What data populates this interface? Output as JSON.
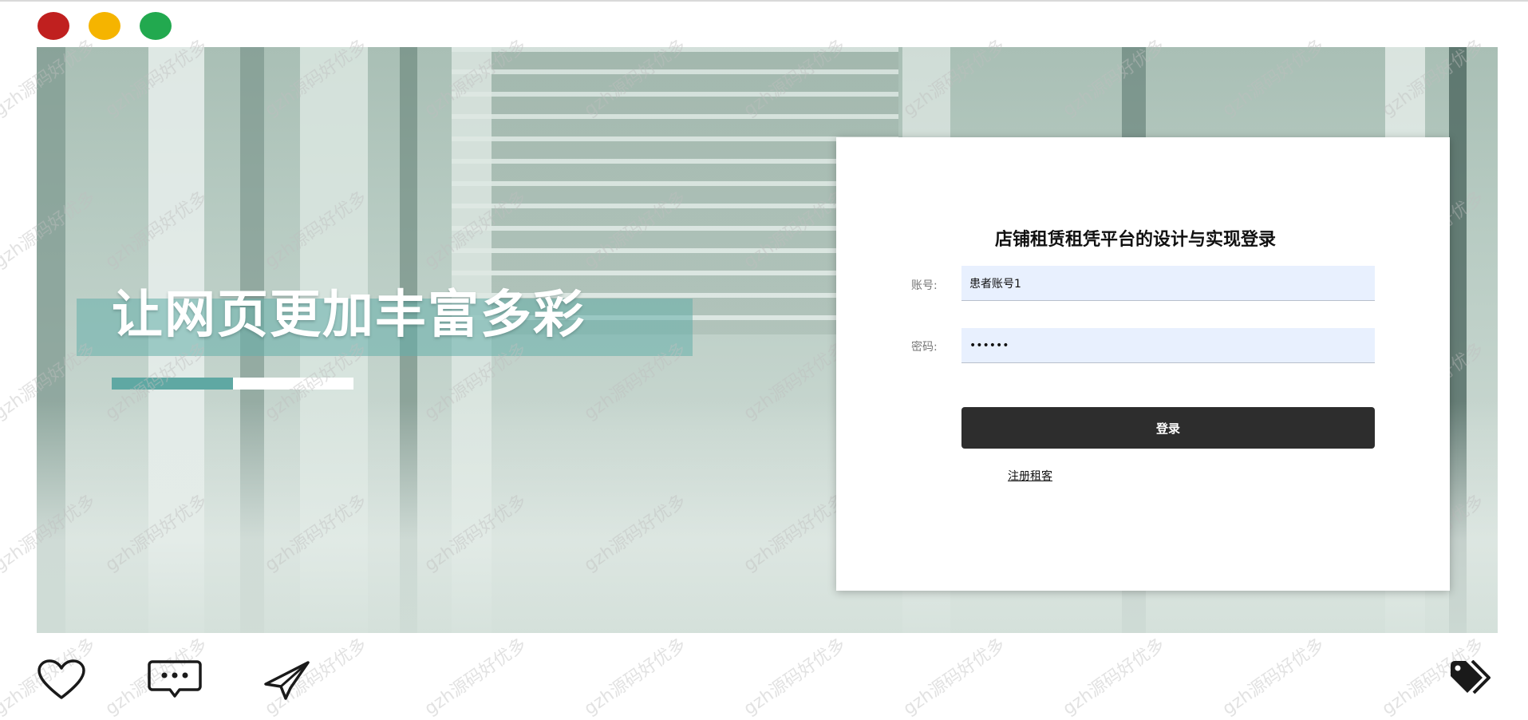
{
  "window": {
    "controls": [
      "close",
      "minimize",
      "maximize"
    ]
  },
  "hero": {
    "headline": "让网页更加丰富多彩"
  },
  "login": {
    "title": "店铺租赁租凭平台的设计与实现登录",
    "account_label": "账号:",
    "account_value": "患者账号1",
    "password_label": "密码:",
    "password_value": "••••••",
    "login_button": "登录",
    "register_link": "注册租客"
  },
  "actions": {
    "icons": [
      "heart-icon",
      "chat-icon",
      "send-icon",
      "tag-icon"
    ]
  },
  "watermark": "gzh源码好优多",
  "colors": {
    "accent_teal": "#5fa8a3",
    "button_dark": "#2d2d2d",
    "input_bg": "#e8f0fe",
    "dot_red": "#c0201f",
    "dot_yellow": "#f5b400",
    "dot_green": "#22a94f"
  }
}
